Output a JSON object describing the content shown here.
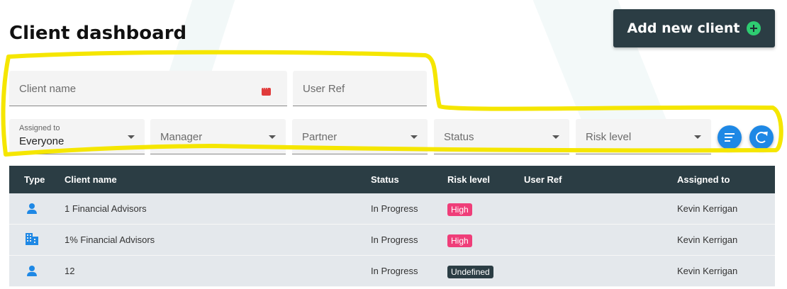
{
  "header": {
    "title": "Client dashboard",
    "add_button_label": "Add new client"
  },
  "filters": {
    "client_name": {
      "placeholder": "Client name"
    },
    "user_ref": {
      "placeholder": "User Ref"
    },
    "assigned_to": {
      "label": "Assigned to",
      "value": "Everyone"
    },
    "manager": {
      "placeholder": "Manager"
    },
    "partner": {
      "placeholder": "Partner"
    },
    "status": {
      "placeholder": "Status"
    },
    "risk_level": {
      "placeholder": "Risk level"
    }
  },
  "table": {
    "columns": [
      "Type",
      "Client name",
      "Status",
      "Risk level",
      "User Ref",
      "Assigned to"
    ],
    "rows": [
      {
        "type": "person-icon",
        "client_name": "1 Financial Advisors",
        "status": "In Progress",
        "risk_level": "High",
        "user_ref": "",
        "assigned_to": "Kevin Kerrigan"
      },
      {
        "type": "building-icon",
        "client_name": "1% Financial Advisors",
        "status": "In Progress",
        "risk_level": "High",
        "user_ref": "",
        "assigned_to": "Kevin Kerrigan"
      },
      {
        "type": "person-icon",
        "client_name": "12",
        "status": "In Progress",
        "risk_level": "Undefined",
        "user_ref": "",
        "assigned_to": "Kevin Kerrigan"
      }
    ]
  },
  "colors": {
    "header_dark": "#2b3d44",
    "accent_blue": "#1e88e5",
    "add_icon_green": "#2ecc71",
    "badge_high": "#ef3e79",
    "badge_undefined": "#2b3d44",
    "highlight_yellow": "#f5e600"
  }
}
